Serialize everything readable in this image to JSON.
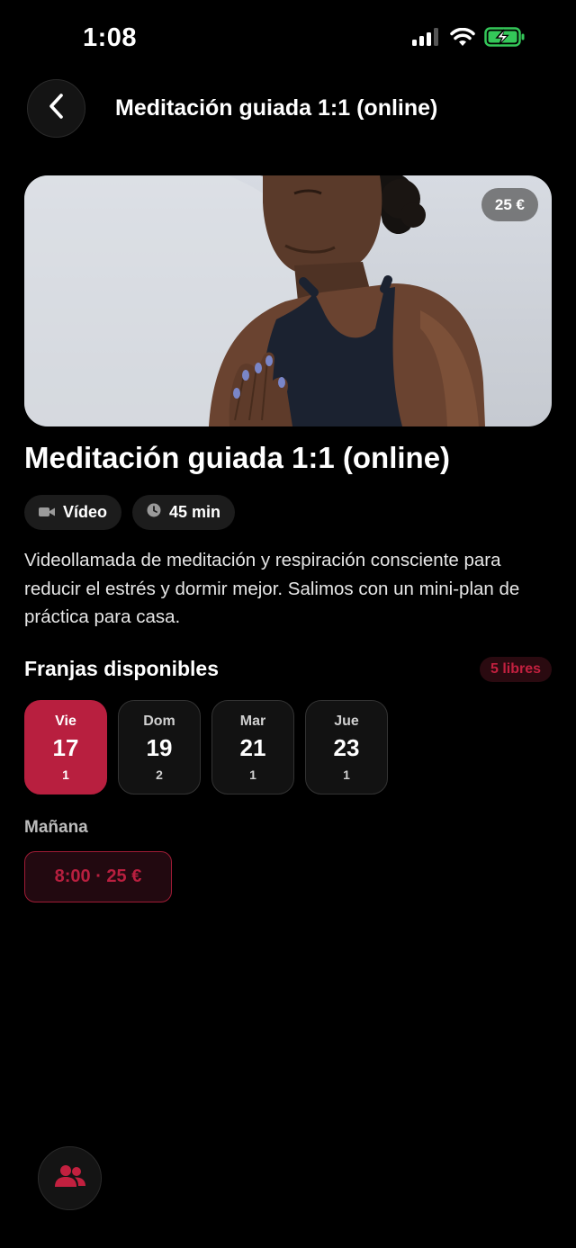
{
  "status_bar": {
    "time": "1:08",
    "icons": [
      "cellular-signal-icon",
      "wifi-icon",
      "battery-charging-icon"
    ],
    "battery_color": "#34c759"
  },
  "header": {
    "back_icon": "chevron-left-icon",
    "title": "Meditación guiada 1:1 (online)"
  },
  "hero": {
    "price_badge": "25 €"
  },
  "service": {
    "title": "Meditación guiada 1:1 (online)",
    "chips": [
      {
        "icon": "video-camera-icon",
        "label": "Vídeo"
      },
      {
        "icon": "clock-icon",
        "label": "45 min"
      }
    ],
    "description": "Videollamada de meditación y respiración consciente para reducir el estrés y dormir mejor. Salimos con un mini-plan de práctica para casa."
  },
  "slots": {
    "section_title": "Franjas disponibles",
    "free_label": "5 libres",
    "days": [
      {
        "name": "Vie",
        "number": "17",
        "count": "1",
        "selected": true
      },
      {
        "name": "Dom",
        "number": "19",
        "count": "2",
        "selected": false
      },
      {
        "name": "Mar",
        "number": "21",
        "count": "1",
        "selected": false
      },
      {
        "name": "Jue",
        "number": "23",
        "count": "1",
        "selected": false
      }
    ],
    "period_label": "Mañana",
    "time_slot": "8:00 · 25 €"
  },
  "fab": {
    "icon": "people-icon"
  },
  "colors": {
    "accent": "#b81f3f",
    "background": "#000000"
  }
}
